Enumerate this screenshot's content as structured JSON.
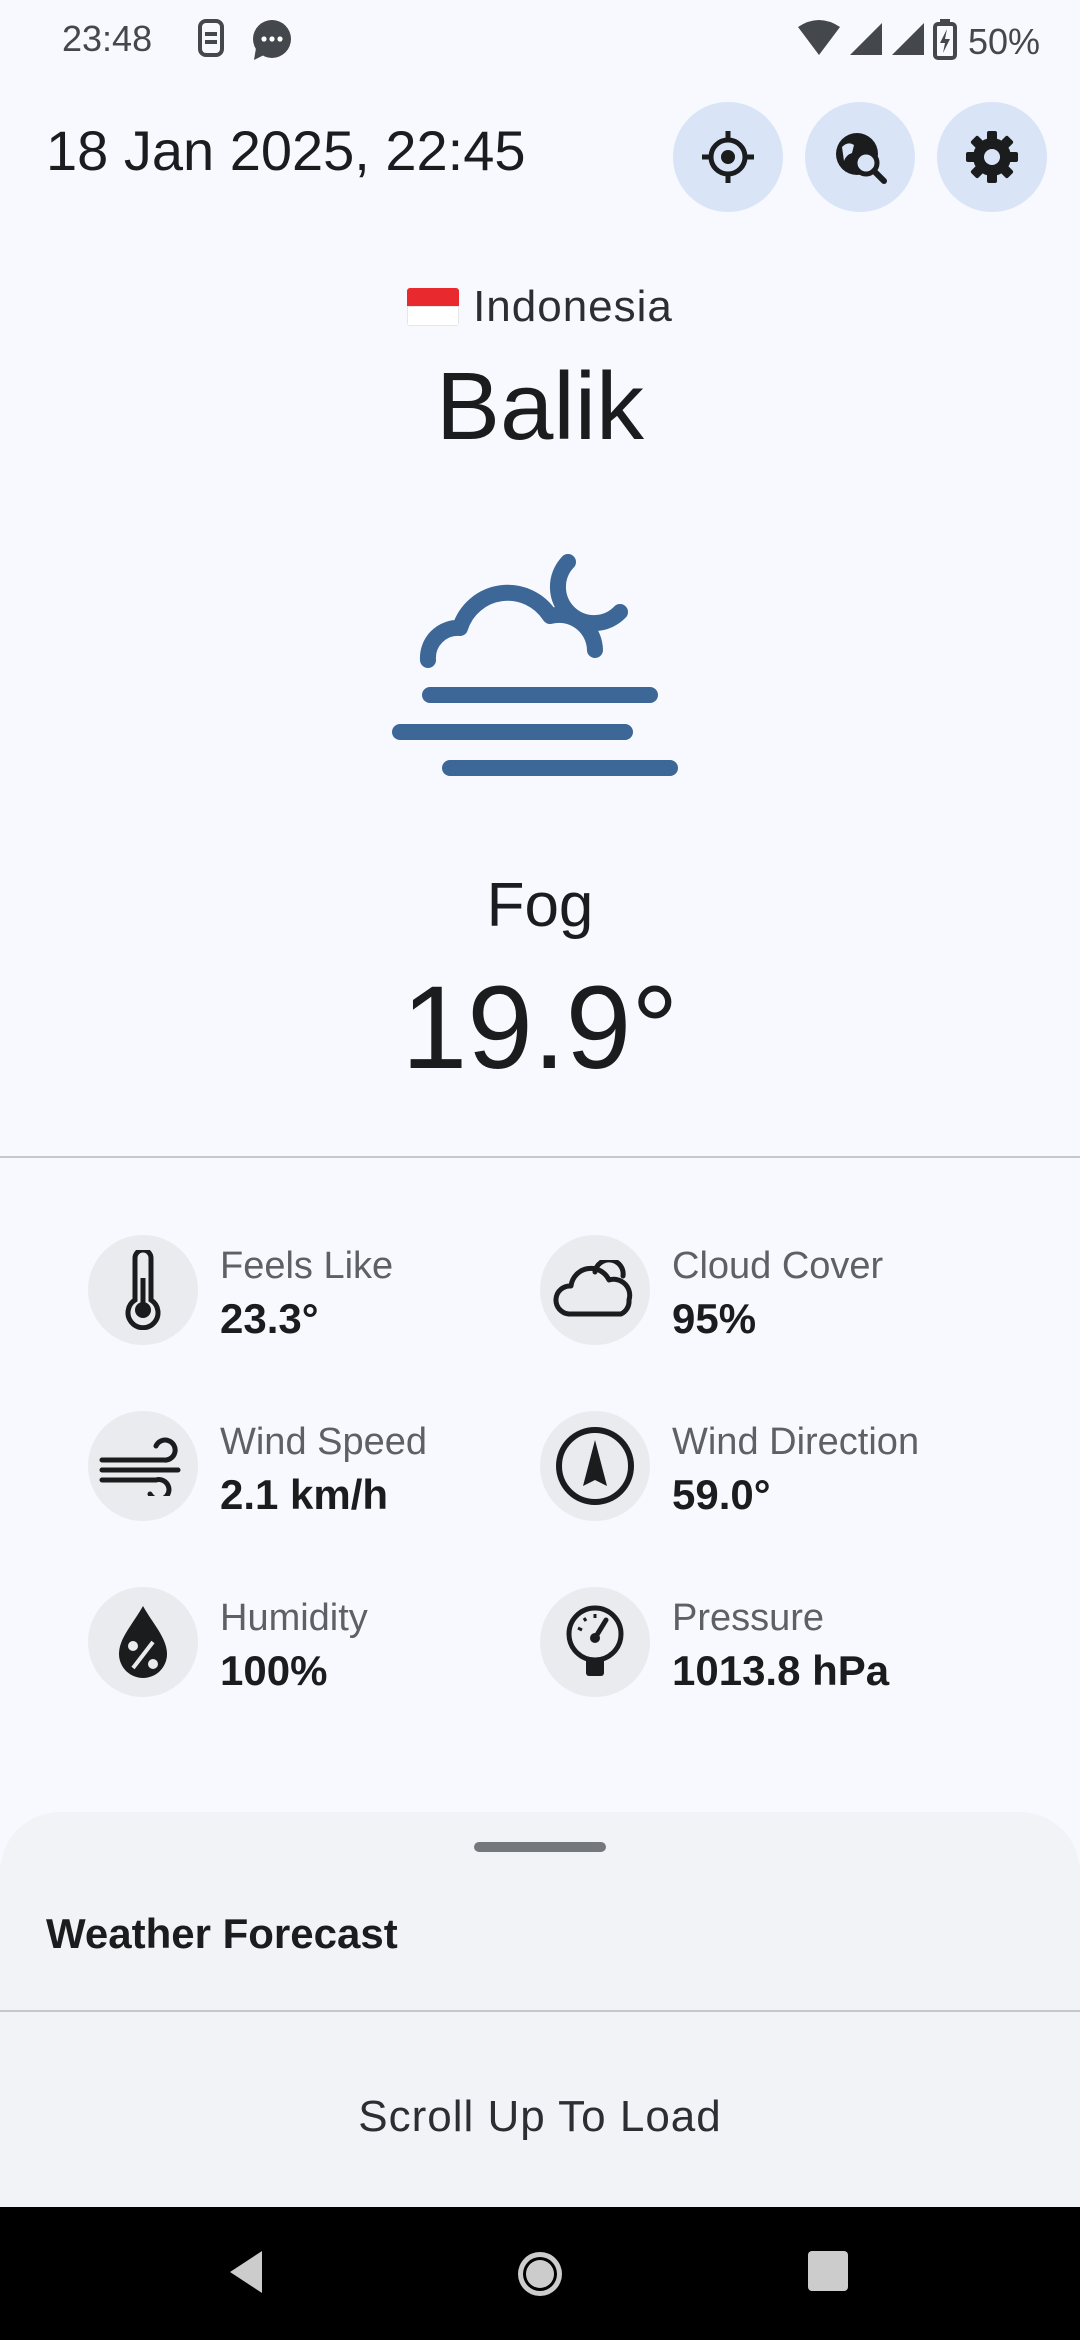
{
  "status_bar": {
    "time": "23:48",
    "battery": "50%",
    "icons": [
      "sim-card-icon",
      "message-bubble-icon",
      "wifi-icon",
      "signal-icon",
      "signal-icon",
      "battery-charging-icon"
    ]
  },
  "header": {
    "datetime": "18 Jan 2025, 22:45",
    "buttons": [
      {
        "name": "my-location-button",
        "icon": "crosshair-icon"
      },
      {
        "name": "search-location-button",
        "icon": "globe-search-icon"
      },
      {
        "name": "settings-button",
        "icon": "gear-icon"
      }
    ]
  },
  "location": {
    "country": "Indonesia",
    "flag_icon": "indonesia-flag-icon",
    "city": "Balik"
  },
  "current": {
    "icon": "fog-night-icon",
    "condition": "Fog",
    "temperature": "19.9°"
  },
  "details": [
    {
      "label": "Feels Like",
      "value": "23.3°",
      "icon": "thermometer-icon"
    },
    {
      "label": "Cloud Cover",
      "value": "95%",
      "icon": "cloud-icon"
    },
    {
      "label": "Wind Speed",
      "value": "2.1 km/h",
      "icon": "wind-icon"
    },
    {
      "label": "Wind Direction",
      "value": "59.0°",
      "icon": "compass-icon"
    },
    {
      "label": "Humidity",
      "value": "100%",
      "icon": "humidity-drop-icon"
    },
    {
      "label": "Pressure",
      "value": "1013.8 hPa",
      "icon": "barometer-icon"
    }
  ],
  "forecast_sheet": {
    "title": "Weather Forecast",
    "hint": "Scroll Up To Load"
  },
  "colors": {
    "background": "#f7f9fe",
    "accent": "#3d6796",
    "button_bg": "#d9e5f7"
  }
}
